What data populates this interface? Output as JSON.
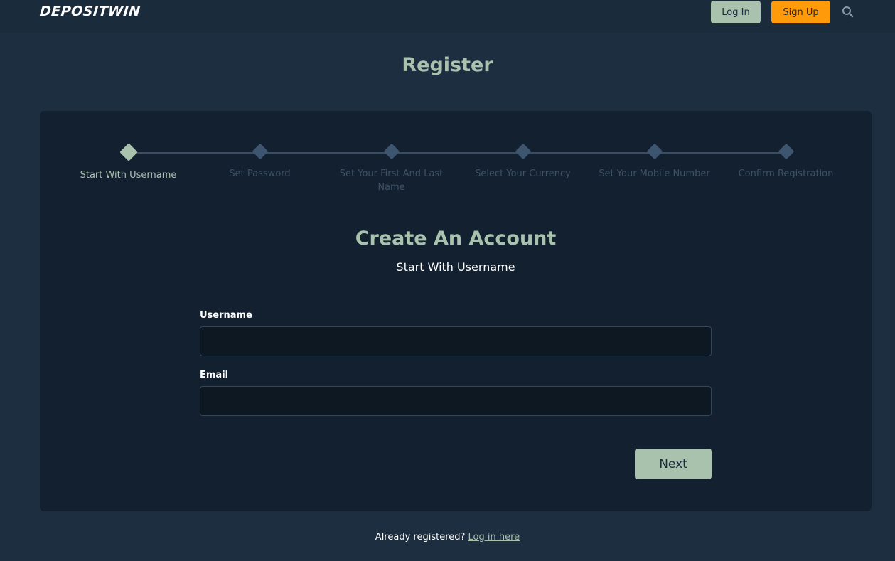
{
  "header": {
    "logo": "DEPOSITWIN",
    "login_label": "Log In",
    "signup_label": "Sign Up"
  },
  "page_title": "Register",
  "stepper": {
    "steps": [
      {
        "label": "Start With Username",
        "active": true
      },
      {
        "label": "Set Password",
        "active": false
      },
      {
        "label": "Set Your First And Last Name",
        "active": false
      },
      {
        "label": "Select Your Currency",
        "active": false
      },
      {
        "label": "Set Your Mobile Number",
        "active": false
      },
      {
        "label": "Confirm Registration",
        "active": false
      }
    ]
  },
  "form": {
    "title": "Create An Account",
    "subtitle": "Start With Username",
    "username_label": "Username",
    "username_value": "",
    "email_label": "Email",
    "email_value": "",
    "next_label": "Next"
  },
  "footer": {
    "prompt": "Already registered?",
    "link_label": "Log in here"
  },
  "colors": {
    "background": "#1c2e40",
    "card": "#122030",
    "accent": "#a9c2ae",
    "signup": "#ff9a0a"
  }
}
